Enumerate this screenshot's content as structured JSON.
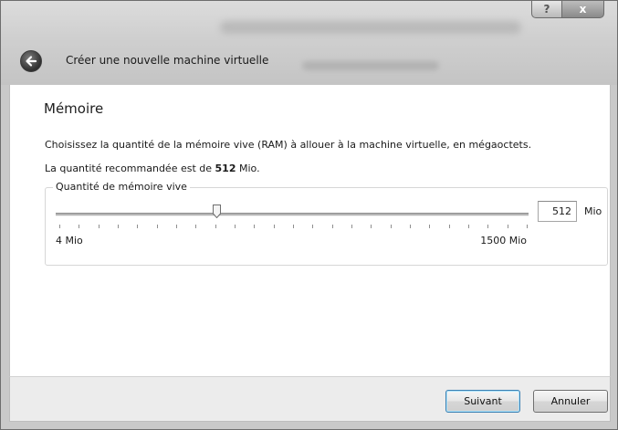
{
  "window": {
    "title": "Créer une nouvelle machine virtuelle",
    "help_glyph": "?",
    "close_glyph": "x"
  },
  "page": {
    "title": "Mémoire",
    "description": "Choisissez la quantité de la mémoire vive (RAM) à allouer à la machine virtuelle, en mégaoctets.",
    "recommended_prefix": "La quantité recommandée est de ",
    "recommended_value": "512",
    "recommended_suffix": " Mio."
  },
  "memory": {
    "group_label": "Quantité de mémoire vive",
    "min_label": "4 Mio",
    "max_label": "1500 Mio",
    "min_value": 4,
    "max_value": 1500,
    "value": "512",
    "unit": "Mio",
    "tick_count": 24
  },
  "buttons": {
    "next": "Suivant",
    "cancel": "Annuler"
  },
  "icons": {
    "back": "back-arrow-icon",
    "help": "help-icon",
    "close": "close-icon"
  }
}
